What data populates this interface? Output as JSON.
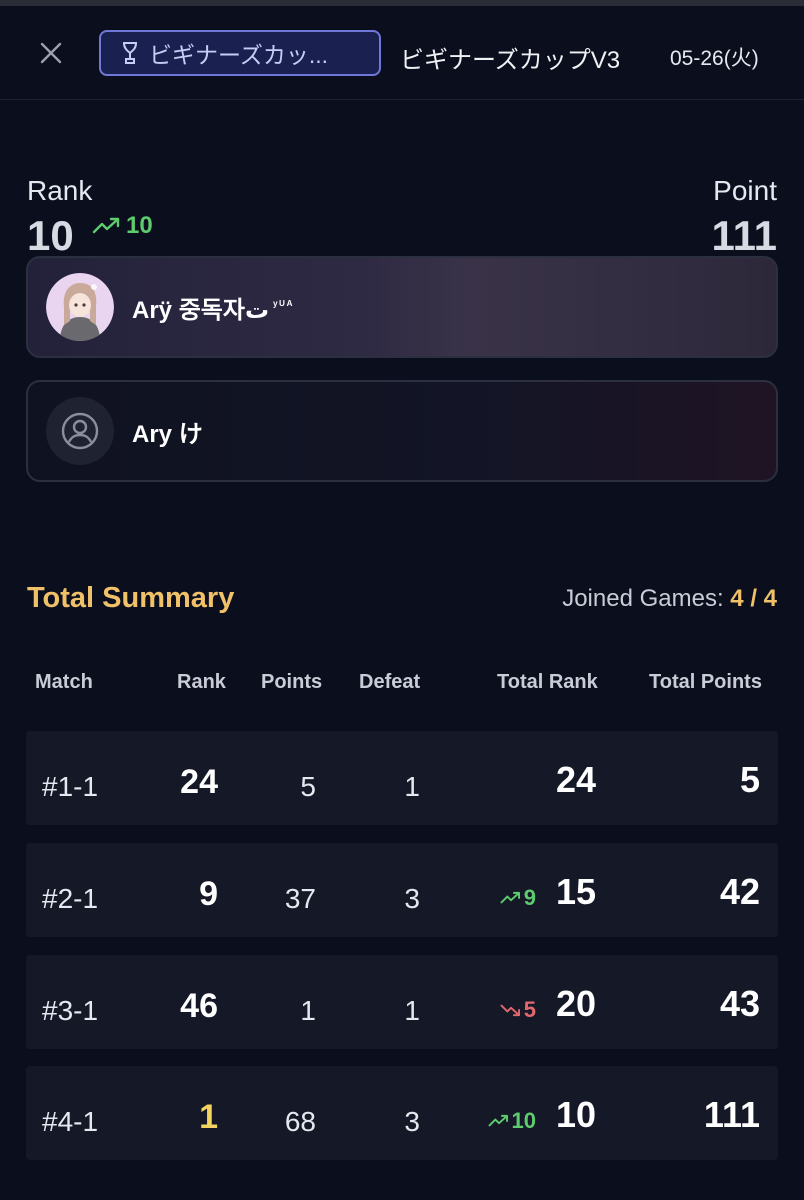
{
  "header": {
    "cup_badge": "ビギナーズカッ...",
    "title": "ビギナーズカップV3",
    "date": "05-26(火)"
  },
  "stats": {
    "rank_label": "Rank",
    "rank_value": "10",
    "rank_change": "10",
    "point_label": "Point",
    "point_value": "111"
  },
  "players": [
    {
      "name": "Arÿ 중독자ت",
      "tag": "ʸᵁᴬ"
    },
    {
      "name": "Ary け"
    }
  ],
  "summary": {
    "title": "Total Summary",
    "joined_label": "Joined Games:",
    "joined_value": "4 / 4"
  },
  "table": {
    "headers": [
      "Match",
      "Rank",
      "Points",
      "Defeat",
      "Total Rank",
      "Total Points"
    ],
    "rows": [
      {
        "match": "#1-1",
        "rank": "24",
        "points": "5",
        "defeat": "1",
        "change": "",
        "total_rank": "24",
        "total_points": "5"
      },
      {
        "match": "#2-1",
        "rank": "9",
        "points": "37",
        "defeat": "3",
        "change": "9",
        "total_rank": "15",
        "total_points": "42"
      },
      {
        "match": "#3-1",
        "rank": "46",
        "points": "1",
        "defeat": "1",
        "change": "5",
        "total_rank": "20",
        "total_points": "43"
      },
      {
        "match": "#4-1",
        "rank": "1",
        "points": "68",
        "defeat": "3",
        "change": "10",
        "total_rank": "10",
        "total_points": "111"
      }
    ]
  },
  "colors": {
    "background": "#0b0f1d",
    "accent_gold": "#f0c169",
    "trend_up": "#5ecb6e",
    "trend_down": "#e2686e",
    "badge_border": "#6f78d6"
  }
}
